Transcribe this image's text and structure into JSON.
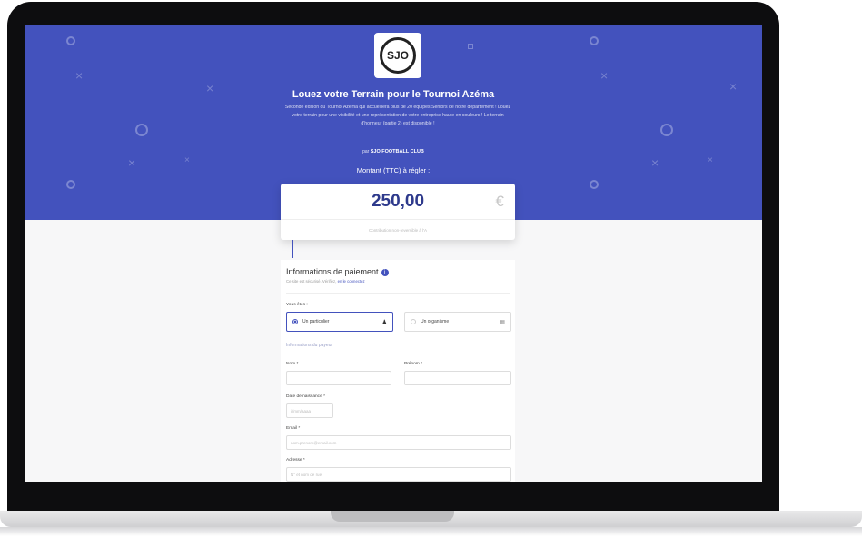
{
  "hero": {
    "title": "Louez votre Terrain pour le Tournoi Azéma",
    "description": "Seconde édition du Tournoi Azéma qui accueillera plus de 20 équipes Séniors de notre département ! Louez votre terrain pour une visibilité et une représentation de votre entreprise haute en couleurs ! Le terrain d'honneur (partie 2) est disponible !",
    "organizer_prefix": "par",
    "organizer": "SJO FOOTBALL CLUB",
    "amount_label": "Montant (TTC) à régler :",
    "logo_text": "SJO"
  },
  "amount": {
    "value": "250,00",
    "currency": "€",
    "hint": "Contribution non-reversible à l'A"
  },
  "form": {
    "title": "Informations de paiement",
    "subtitle_text": "Ce site est sécurisé. Vérifiez,",
    "subtitle_link": "en le connectez",
    "you_are_label": "Vous êtes :",
    "option_individual": "Un particulier",
    "option_organization": "Un organisme",
    "payer_section": "Informations du payeur",
    "nom_label": "Nom *",
    "prenom_label": "Prénom *",
    "dob_label": "Date de naissance *",
    "dob_placeholder": "jj/mm/aaaa",
    "email_label": "Email *",
    "email_placeholder": "nom.prenom@email.com",
    "adresse_label": "Adresse *",
    "adresse_placeholder": "N° et nom de rue"
  },
  "colors": {
    "brand": "#4352bd",
    "amount_text": "#2e3a8c"
  }
}
